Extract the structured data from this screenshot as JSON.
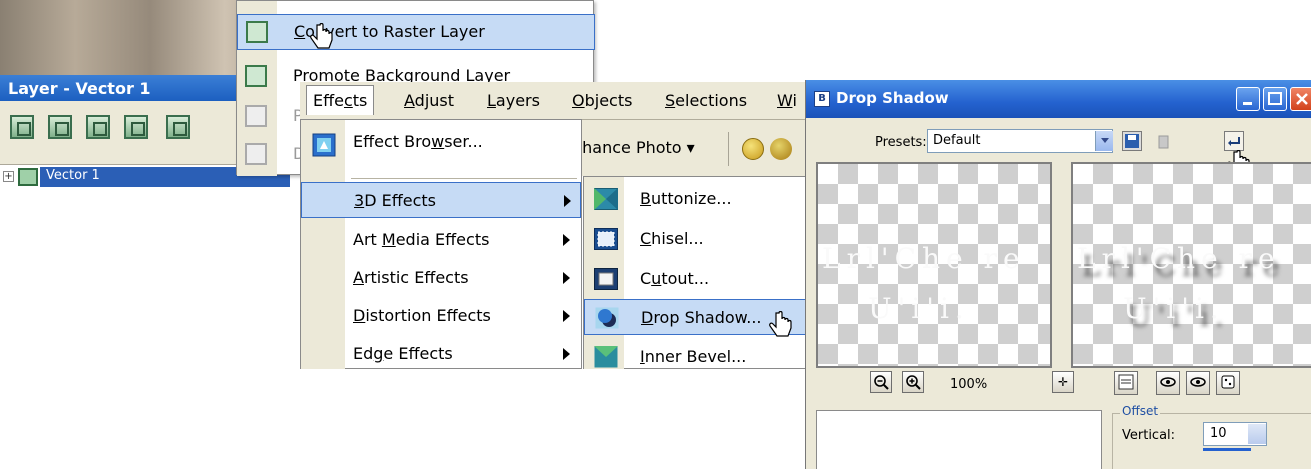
{
  "layers_panel": {
    "title": "Layer - Vector 1",
    "tree_plus": "+",
    "layer_name": "Vector 1"
  },
  "context_menu": {
    "items": [
      {
        "label": "Convert to Raster Layer",
        "underline": "C",
        "rest": "onvert to Raster Layer"
      },
      {
        "label": "Promote Background Layer",
        "visible": "Promote Background Layer"
      },
      {
        "label": "P"
      },
      {
        "label": "D"
      }
    ]
  },
  "menubar": {
    "items": [
      {
        "label": "Effects",
        "pre": "Effe",
        "u": "c",
        "post": "ts"
      },
      {
        "label": "Adjust",
        "pre": "",
        "u": "A",
        "post": "djust"
      },
      {
        "label": "Layers",
        "pre": "",
        "u": "L",
        "post": "ayers"
      },
      {
        "label": "Objects",
        "pre": "",
        "u": "O",
        "post": "bjects"
      },
      {
        "label": "Selections",
        "pre": "",
        "u": "S",
        "post": "elections"
      },
      {
        "label": "Wi",
        "pre": "",
        "u": "W",
        "post": "i"
      }
    ]
  },
  "toolbar": {
    "enhance_photo": "nhance Photo ▾"
  },
  "effects_menu": {
    "items": [
      {
        "pre": "Effect Bro",
        "u": "w",
        "post": "ser...",
        "submenu": false
      },
      {
        "pre": "",
        "u": "3",
        "post": "D Effects",
        "submenu": true,
        "selected": true
      },
      {
        "pre": "Art ",
        "u": "M",
        "post": "edia Effects",
        "submenu": true
      },
      {
        "pre": "",
        "u": "A",
        "post": "rtistic Effects",
        "submenu": true
      },
      {
        "pre": "",
        "u": "D",
        "post": "istortion Effects",
        "submenu": true
      },
      {
        "pre": "Ed",
        "u": "g",
        "post": "e Effects",
        "submenu": true
      }
    ]
  },
  "submenu_3d": {
    "items": [
      {
        "pre": "",
        "u": "B",
        "post": "uttonize..."
      },
      {
        "pre": "",
        "u": "C",
        "post": "hisel..."
      },
      {
        "pre": "C",
        "u": "u",
        "post": "tout..."
      },
      {
        "pre": "",
        "u": "D",
        "post": "rop Shadow...",
        "selected": true
      },
      {
        "pre": "",
        "u": "I",
        "post": "nner Bevel..."
      }
    ]
  },
  "drop_shadow_dialog": {
    "title": "Drop Shadow",
    "presets_label": "Presets:",
    "presets_value": "Default",
    "preview_left_line1": "Lrl'Che re",
    "preview_left_line2": "U'i'i.",
    "preview_right_line1": "Lrl'Che re",
    "preview_right_line2": "U'i'i.",
    "zoom_out_glyph": "−",
    "zoom_in_glyph": "+",
    "zoom_level": "100%",
    "pan_glyph": "✛",
    "offset_group_label": "Offset",
    "vertical_label": "Vertical:",
    "vertical_value": "10"
  }
}
